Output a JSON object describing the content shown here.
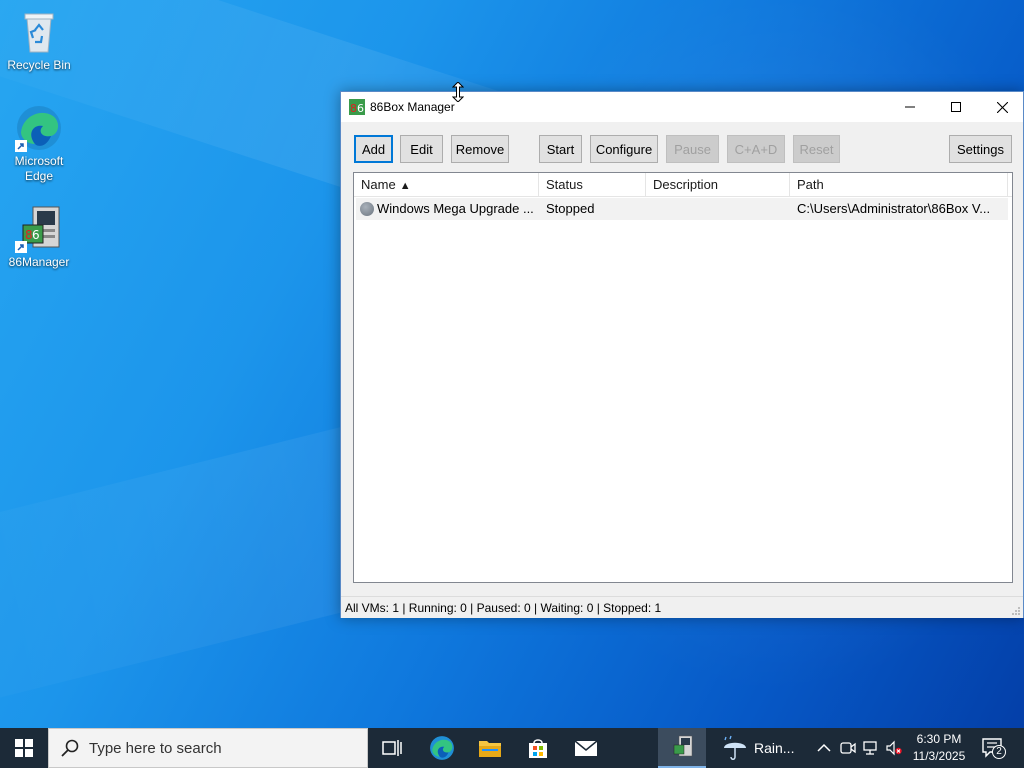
{
  "desktop": {
    "icons": [
      {
        "label": "Recycle Bin"
      },
      {
        "label": "Microsoft Edge"
      },
      {
        "label": "86Manager"
      }
    ]
  },
  "window": {
    "title": "86Box Manager",
    "toolbar": {
      "add": "Add",
      "edit": "Edit",
      "remove": "Remove",
      "start": "Start",
      "configure": "Configure",
      "pause": "Pause",
      "cad": "C+A+D",
      "reset": "Reset",
      "settings": "Settings"
    },
    "columns": {
      "name": "Name",
      "status": "Status",
      "description": "Description",
      "path": "Path",
      "sort_indicator": "▲"
    },
    "rows": [
      {
        "name": "Windows Mega Upgrade ...",
        "status": "Stopped",
        "description": "",
        "path": "C:\\Users\\Administrator\\86Box V..."
      }
    ],
    "statusbar": "All VMs: 1 | Running: 0 | Paused: 0 | Waiting: 0 | Stopped: 1"
  },
  "taskbar": {
    "search_placeholder": "Type here to search",
    "weather": "Rain...",
    "time": "6:30 PM",
    "date": "11/3/2025",
    "notification_count": "2"
  },
  "colors": {
    "accent": "#0078d7",
    "taskbar": "#1c2a38"
  }
}
